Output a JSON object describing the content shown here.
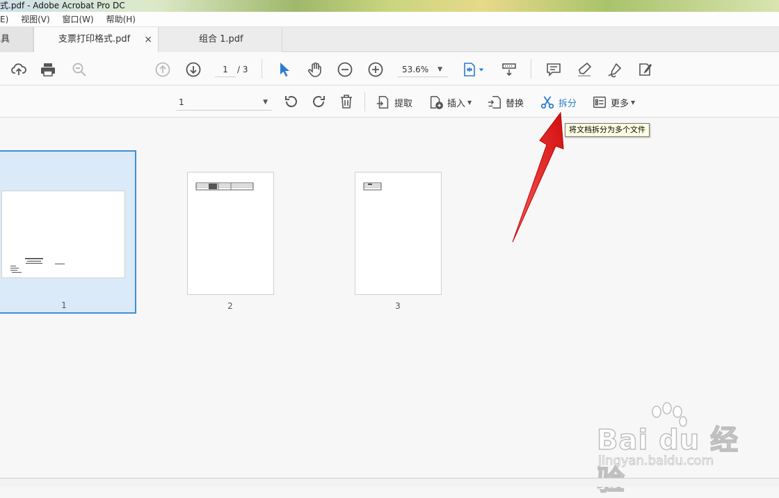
{
  "window": {
    "title": "式.pdf - Adobe Acrobat Pro DC"
  },
  "menu": {
    "items": [
      "E)",
      "视图(V)",
      "窗口(W)",
      "帮助(H)"
    ]
  },
  "tabs": {
    "tools": "工具",
    "active": "支票打印格式.pdf",
    "active_close": "×",
    "other": "组合 1.pdf"
  },
  "toolbar": {
    "page_current": "1",
    "page_total": "/ 3",
    "zoom": "53.6%"
  },
  "organize": {
    "range_value": "1",
    "extract_label": "提取",
    "insert_label": "插入",
    "replace_label": "替换",
    "split_label": "拆分",
    "more_label": "更多"
  },
  "tooltip": {
    "text": "将文档拆分为多个文件"
  },
  "thumbnails": [
    {
      "label": "1",
      "selected": true
    },
    {
      "label": "2",
      "selected": false
    },
    {
      "label": "3",
      "selected": false
    }
  ],
  "watermark": {
    "brand": "Bai du 经验",
    "url": "jingyan.baidu.com"
  },
  "colors": {
    "accent": "#2b7bd0",
    "selection": "#dbeaf8",
    "arrow": "#e01f1f"
  }
}
